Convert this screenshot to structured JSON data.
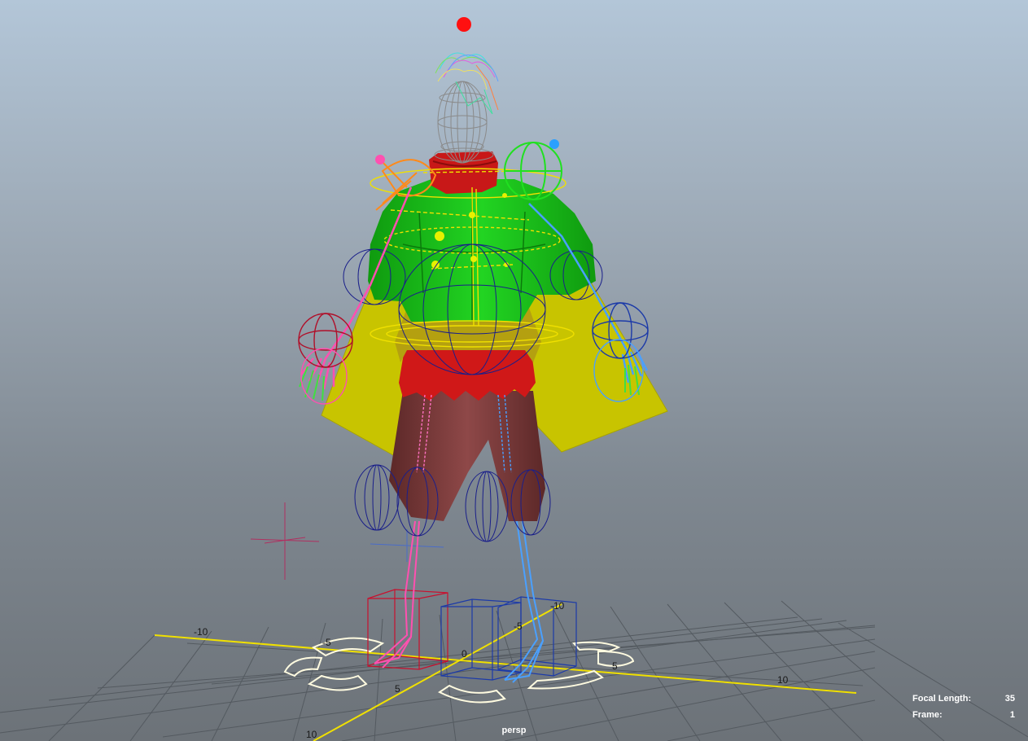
{
  "viewport": {
    "camera_name": "persp",
    "hud": {
      "focal_length_label": "Focal Length:",
      "focal_length_value": "35",
      "frame_label": "Frame:",
      "frame_value": "1"
    },
    "grid_labels": {
      "x_neg_10": "-10",
      "x_neg_5": "-5",
      "origin": "0",
      "x_pos_5": "5",
      "x_pos_10": "10",
      "z_neg_10": "-10",
      "z_neg_5": "-5",
      "z_pos_5": "5",
      "z_pos_10": "10"
    }
  },
  "colors": {
    "background_top": "#b3c6d8",
    "background_bottom": "#6c7278",
    "grid_axis": "#f0e000",
    "jacket": "#19c419",
    "cape": "#c8c400",
    "collar": "#c81818",
    "pants": "#7e3c3c",
    "left_limb_controls": "#ff50b0",
    "right_limb_controls": "#4aa0ff",
    "joint_spheres": "#1a1f8a"
  }
}
